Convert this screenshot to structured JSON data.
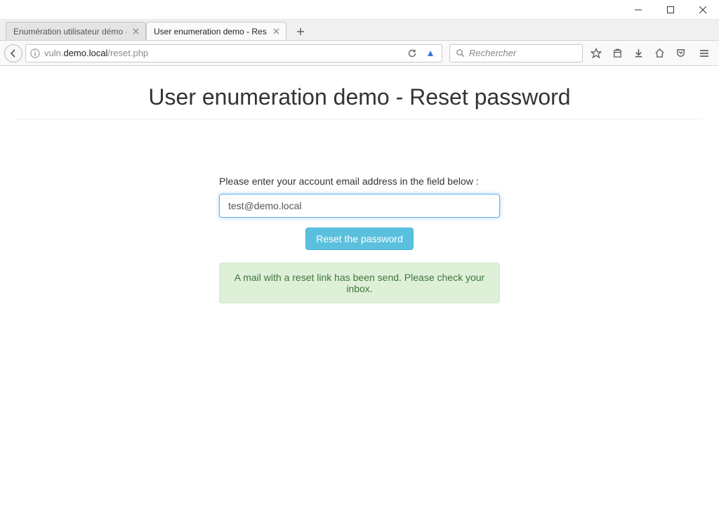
{
  "window": {
    "tabs": [
      {
        "title": "Enumération utilisateur démo - I",
        "active": false
      },
      {
        "title": "User enumeration demo - Reset",
        "active": true
      }
    ]
  },
  "toolbar": {
    "url_plain_prefix": "vuln.",
    "url_dark_mid": "demo.local",
    "url_plain_suffix": "/reset.php",
    "search_placeholder": "Rechercher"
  },
  "page": {
    "title": "User enumeration demo - Reset password",
    "form_label": "Please enter your account email address in the field below :",
    "email_value": "test@demo.local",
    "submit_label": "Reset the password",
    "alert_text": "A mail with a reset link has been send. Please check your inbox."
  }
}
